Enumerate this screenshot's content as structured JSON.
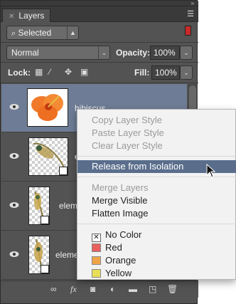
{
  "panel": {
    "tab_label": "Layers",
    "filter_label": "Selected",
    "blend_mode": "Normal",
    "opacity_label": "Opacity:",
    "opacity_value": "100%",
    "lock_label": "Lock:",
    "fill_label": "Fill:",
    "fill_value": "100%"
  },
  "layers": [
    {
      "name": "hibiscus",
      "selected": true
    },
    {
      "name": "e",
      "selected": false
    },
    {
      "name": "elem",
      "selected": false
    },
    {
      "name": "eleme",
      "selected": false
    }
  ],
  "menu": {
    "items": [
      {
        "label": "Copy Layer Style",
        "enabled": false
      },
      {
        "label": "Paste Layer Style",
        "enabled": false
      },
      {
        "label": "Clear Layer Style",
        "enabled": false
      },
      {
        "label": "Release from Isolation",
        "enabled": true,
        "highlighted": true
      },
      {
        "label": "Merge Layers",
        "enabled": false
      },
      {
        "label": "Merge Visible",
        "enabled": true
      },
      {
        "label": "Flatten Image",
        "enabled": true
      },
      {
        "label": "No Color",
        "enabled": true
      },
      {
        "label": "Red",
        "enabled": true,
        "color": "#e8605f"
      },
      {
        "label": "Orange",
        "enabled": true,
        "color": "#f0a44a"
      },
      {
        "label": "Yellow",
        "enabled": true,
        "color": "#e6df57"
      }
    ]
  },
  "icons": [
    "close-icon",
    "panel-menu-icon",
    "search-icon",
    "lock-pixels-icon",
    "lock-brush-icon",
    "lock-move-icon",
    "lock-all-icon",
    "eye-icon",
    "link-icon",
    "fx-icon",
    "mask-icon",
    "adjustment-icon",
    "folder-icon",
    "new-layer-icon",
    "trash-icon"
  ],
  "colors": {
    "panel_bg": "#535353",
    "selected_layer": "#6e7c95",
    "menu_highlight": "#5a6e8c",
    "filter_indicator": "#c92a2a"
  }
}
